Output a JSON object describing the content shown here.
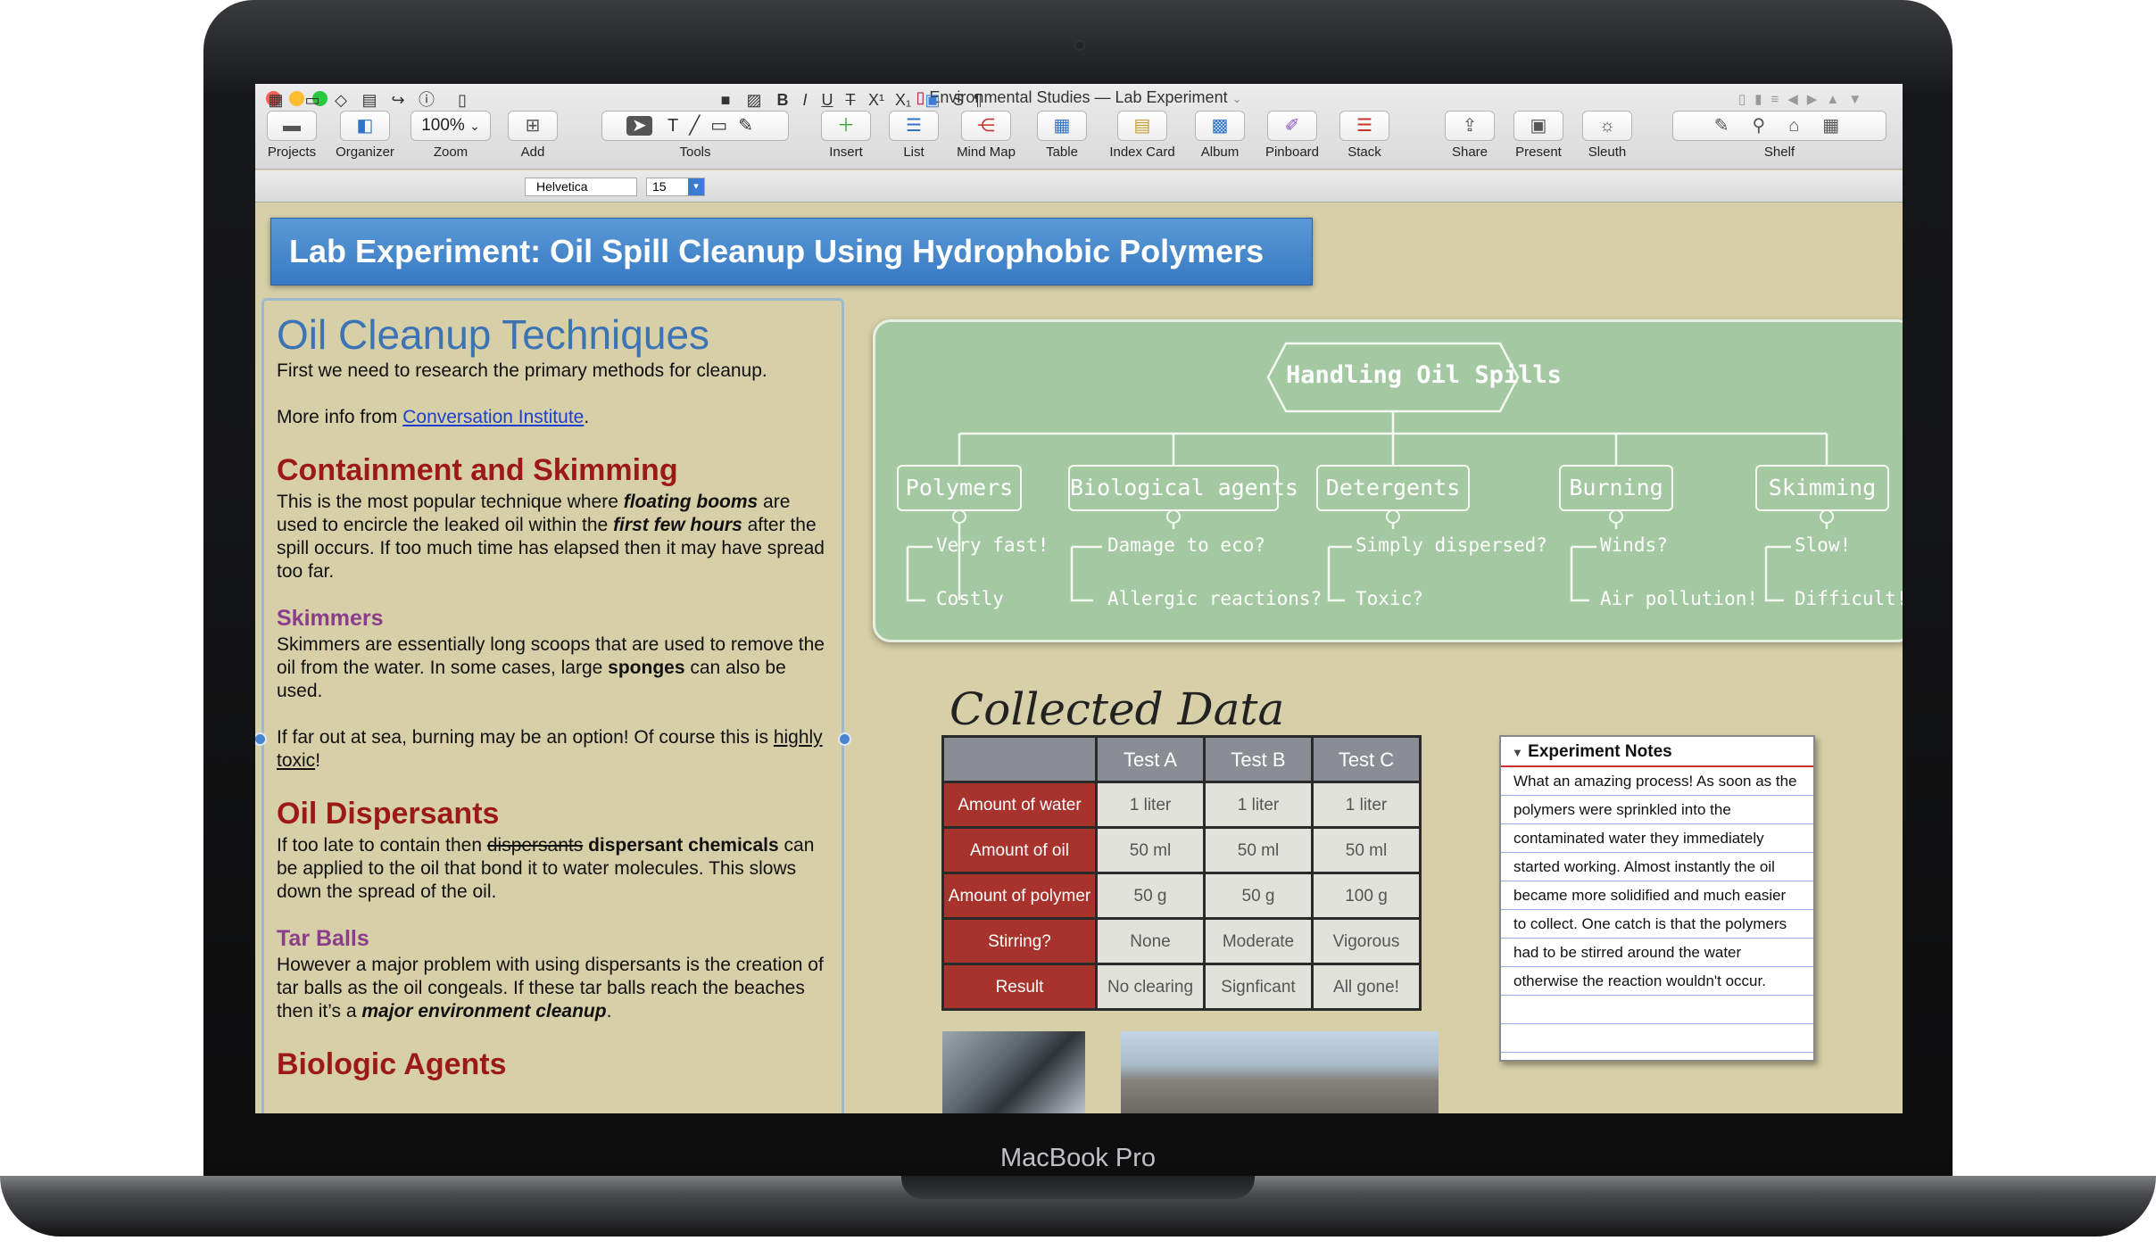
{
  "window": {
    "title": "Environmental Studies — Lab Experiment"
  },
  "device": {
    "brand": "MacBook Pro"
  },
  "toolbar": {
    "projects": "Projects",
    "organizer": "Organizer",
    "zoom_value": "100%",
    "zoom": "Zoom",
    "add": "Add",
    "tools": "Tools",
    "insert": "Insert",
    "list": "List",
    "mindmap": "Mind Map",
    "table": "Table",
    "indexcard": "Index Card",
    "album": "Album",
    "pinboard": "Pinboard",
    "stack": "Stack",
    "share": "Share",
    "present": "Present",
    "sleuth": "Sleuth",
    "shelf": "Shelf"
  },
  "format": {
    "font": "Helvetica",
    "size": "15",
    "bold": "B",
    "italic": "I",
    "underline": "U",
    "strike": "T",
    "super": "X¹",
    "sub": "X₁",
    "style": "S",
    "para": "¶"
  },
  "doc": {
    "banner": "Lab Experiment: Oil Spill Cleanup Using Hydrophobic Polymers",
    "h_techniques": "Oil Cleanup Techniques",
    "p_intro": "First we need to research the primary methods for cleanup.",
    "p_more": "More info from ",
    "link": "Conversation Institute",
    "h_containment": "Containment and Skimming",
    "p_cont_1": "This is the most popular technique where ",
    "p_cont_b1": "floating booms",
    "p_cont_2": " are used to encircle the leaked oil within the ",
    "p_cont_i1": "first few hours",
    "p_cont_3": " after the spill occurs. If too much time has elapsed then it may have spread too far.",
    "h_skimmers": "Skimmers",
    "p_skim_1": "Skimmers are essentially long scoops that are used to remove the oil from the water. In some cases, large ",
    "p_skim_b1": "sponges",
    "p_skim_2": " can also be used.",
    "p_burn_1": "If far out at sea, burning may be an option! Of course this is ",
    "p_burn_u": "highly toxic",
    "p_burn_2": "!",
    "h_dispersants": "Oil Dispersants",
    "p_disp_1": "If too late to contain then ",
    "p_disp_st": "dispersants",
    "p_disp_b": "dispersant chemicals",
    "p_disp_2": " can be applied to the oil that bond it to water molecules. This slows down the spread of the oil.",
    "h_tarballs": "Tar Balls",
    "p_tar_1": "However a major problem with using dispersants is the creation of tar balls as the oil congeals. If these tar balls reach the beaches then it’s a ",
    "p_tar_bi": "major environment cleanup",
    "p_tar_2": ".",
    "h_biologic": "Biologic Agents"
  },
  "mindmap": {
    "root": "Handling Oil Spills",
    "branches": [
      {
        "label": "Polymers",
        "leaves": [
          "Very fast!",
          "Costly"
        ]
      },
      {
        "label": "Biological agents",
        "leaves": [
          "Damage to eco?",
          "Allergic reactions?"
        ]
      },
      {
        "label": "Detergents",
        "leaves": [
          "Simply dispersed?",
          "Toxic?"
        ]
      },
      {
        "label": "Burning",
        "leaves": [
          "Winds?",
          "Air pollution!"
        ]
      },
      {
        "label": "Skimming",
        "leaves": [
          "Slow!",
          "Difficult!"
        ]
      }
    ]
  },
  "data": {
    "title": "Collected Data",
    "columns": [
      "",
      "Test A",
      "Test B",
      "Test C"
    ],
    "rows": [
      {
        "label": "Amount of water",
        "values": [
          "1 liter",
          "1 liter",
          "1 liter"
        ]
      },
      {
        "label": "Amount of oil",
        "values": [
          "50 ml",
          "50 ml",
          "50 ml"
        ]
      },
      {
        "label": "Amount of polymer",
        "values": [
          "50 g",
          "50 g",
          "100 g"
        ]
      },
      {
        "label": "Stirring?",
        "values": [
          "None",
          "Moderate",
          "Vigorous"
        ]
      },
      {
        "label": "Result",
        "values": [
          "No clearing",
          "Signficant",
          "All gone!"
        ]
      }
    ]
  },
  "notes": {
    "title": "Experiment Notes",
    "lines": [
      "What an amazing process! As soon as the",
      "polymers were sprinkled into the",
      "contaminated water they immediately",
      "started working. Almost instantly the oil",
      "became more solidified and much easier",
      "to collect. One catch is that the polymers",
      "had to be stirred around the water",
      "otherwise the reaction wouldn't occur.",
      "",
      ""
    ]
  },
  "colors": {
    "banner": "#3f82c9",
    "heading_red": "#9c1a16",
    "heading_purple": "#8b3d8b",
    "mindmap_bg": "#a4c9a2",
    "table_row_header": "#a8332d"
  }
}
